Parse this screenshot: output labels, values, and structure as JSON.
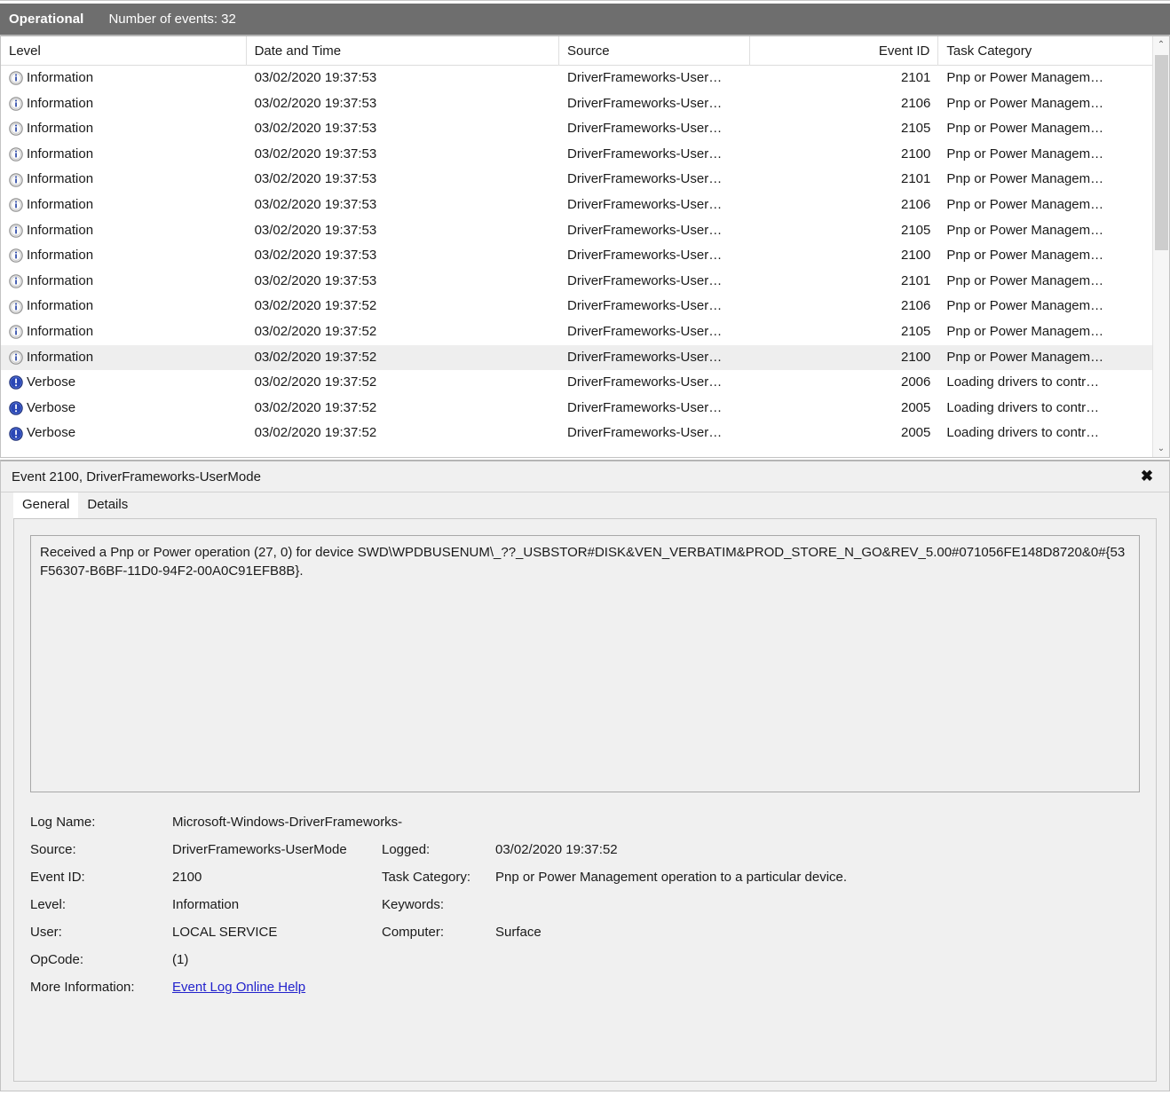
{
  "header": {
    "log_name": "Operational",
    "events_count_label": "Number of events: 32",
    "bar_color": "#6e6e6e"
  },
  "list": {
    "columns": [
      {
        "key": "level",
        "label": "Level"
      },
      {
        "key": "datetime",
        "label": "Date and Time"
      },
      {
        "key": "source",
        "label": "Source"
      },
      {
        "key": "event_id",
        "label": "Event ID"
      },
      {
        "key": "task_category",
        "label": "Task Category"
      }
    ],
    "rows": [
      {
        "level": "Information",
        "icon": "information-icon",
        "datetime": "03/02/2020 19:37:53",
        "source": "DriverFrameworks-User…",
        "event_id": "2101",
        "task_category": "Pnp or Power Managem…",
        "selected": false
      },
      {
        "level": "Information",
        "icon": "information-icon",
        "datetime": "03/02/2020 19:37:53",
        "source": "DriverFrameworks-User…",
        "event_id": "2106",
        "task_category": "Pnp or Power Managem…",
        "selected": false
      },
      {
        "level": "Information",
        "icon": "information-icon",
        "datetime": "03/02/2020 19:37:53",
        "source": "DriverFrameworks-User…",
        "event_id": "2105",
        "task_category": "Pnp or Power Managem…",
        "selected": false
      },
      {
        "level": "Information",
        "icon": "information-icon",
        "datetime": "03/02/2020 19:37:53",
        "source": "DriverFrameworks-User…",
        "event_id": "2100",
        "task_category": "Pnp or Power Managem…",
        "selected": false
      },
      {
        "level": "Information",
        "icon": "information-icon",
        "datetime": "03/02/2020 19:37:53",
        "source": "DriverFrameworks-User…",
        "event_id": "2101",
        "task_category": "Pnp or Power Managem…",
        "selected": false
      },
      {
        "level": "Information",
        "icon": "information-icon",
        "datetime": "03/02/2020 19:37:53",
        "source": "DriverFrameworks-User…",
        "event_id": "2106",
        "task_category": "Pnp or Power Managem…",
        "selected": false
      },
      {
        "level": "Information",
        "icon": "information-icon",
        "datetime": "03/02/2020 19:37:53",
        "source": "DriverFrameworks-User…",
        "event_id": "2105",
        "task_category": "Pnp or Power Managem…",
        "selected": false
      },
      {
        "level": "Information",
        "icon": "information-icon",
        "datetime": "03/02/2020 19:37:53",
        "source": "DriverFrameworks-User…",
        "event_id": "2100",
        "task_category": "Pnp or Power Managem…",
        "selected": false
      },
      {
        "level": "Information",
        "icon": "information-icon",
        "datetime": "03/02/2020 19:37:53",
        "source": "DriverFrameworks-User…",
        "event_id": "2101",
        "task_category": "Pnp or Power Managem…",
        "selected": false
      },
      {
        "level": "Information",
        "icon": "information-icon",
        "datetime": "03/02/2020 19:37:52",
        "source": "DriverFrameworks-User…",
        "event_id": "2106",
        "task_category": "Pnp or Power Managem…",
        "selected": false
      },
      {
        "level": "Information",
        "icon": "information-icon",
        "datetime": "03/02/2020 19:37:52",
        "source": "DriverFrameworks-User…",
        "event_id": "2105",
        "task_category": "Pnp or Power Managem…",
        "selected": false
      },
      {
        "level": "Information",
        "icon": "information-icon",
        "datetime": "03/02/2020 19:37:52",
        "source": "DriverFrameworks-User…",
        "event_id": "2100",
        "task_category": "Pnp or Power Managem…",
        "selected": true
      },
      {
        "level": "Verbose",
        "icon": "verbose-icon",
        "datetime": "03/02/2020 19:37:52",
        "source": "DriverFrameworks-User…",
        "event_id": "2006",
        "task_category": "Loading drivers to contr…",
        "selected": false
      },
      {
        "level": "Verbose",
        "icon": "verbose-icon",
        "datetime": "03/02/2020 19:37:52",
        "source": "DriverFrameworks-User…",
        "event_id": "2005",
        "task_category": "Loading drivers to contr…",
        "selected": false
      },
      {
        "level": "Verbose",
        "icon": "verbose-icon",
        "datetime": "03/02/2020 19:37:52",
        "source": "DriverFrameworks-User…",
        "event_id": "2005",
        "task_category": "Loading drivers to contr…",
        "selected": false
      }
    ],
    "scrollbar": {
      "up_glyph": "⌃",
      "down_glyph": "⌄"
    }
  },
  "detail": {
    "title": "Event 2100, DriverFrameworks-UserMode",
    "close_glyph": "✖",
    "tabs": [
      {
        "label": "General",
        "active": true
      },
      {
        "label": "Details",
        "active": false
      }
    ],
    "description": "Received a Pnp or Power operation (27, 0) for device SWD\\WPDBUSENUM\\_??_USBSTOR#DISK&VEN_VERBATIM&PROD_STORE_N_GO&REV_5.00#071056FE148D8720&0#{53F56307-B6BF-11D0-94F2-00A0C91EFB8B}.",
    "fields_left": [
      {
        "label": "Log Name:",
        "value": "Microsoft-Windows-DriverFrameworks-UserMode/Operational"
      },
      {
        "label": "Source:",
        "value": "DriverFrameworks-UserMode"
      },
      {
        "label": "Event ID:",
        "value": "2100"
      },
      {
        "label": "Level:",
        "value": "Information"
      },
      {
        "label": "User:",
        "value": "LOCAL SERVICE"
      },
      {
        "label": "OpCode:",
        "value": "(1)"
      }
    ],
    "fields_right": [
      {
        "label": "Logged:",
        "value": "03/02/2020 19:37:52"
      },
      {
        "label": "Task Category:",
        "value": "Pnp or Power Management operation to a particular device."
      },
      {
        "label": "Keywords:",
        "value": ""
      },
      {
        "label": "Computer:",
        "value": "Surface"
      }
    ],
    "more_info": {
      "label": "More Information:",
      "link_text": "Event Log Online Help",
      "link_color": "#2222cc"
    }
  }
}
